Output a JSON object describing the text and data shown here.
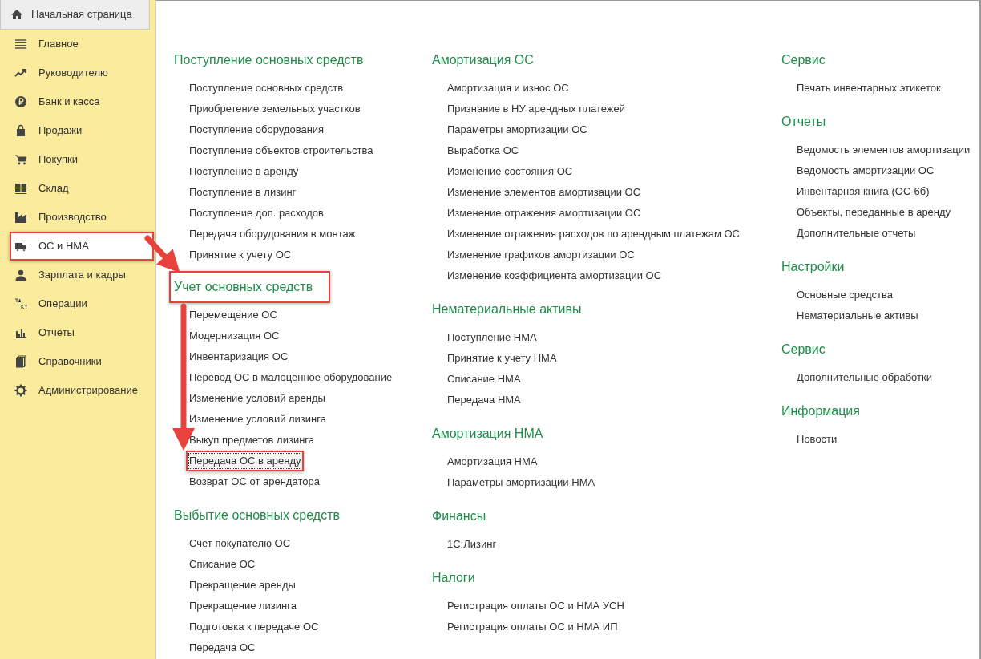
{
  "home_tab": {
    "label": "Начальная страница"
  },
  "sidebar": {
    "items": [
      {
        "label": "Главное",
        "selected": false,
        "highlighted": false
      },
      {
        "label": "Руководителю",
        "selected": false,
        "highlighted": false
      },
      {
        "label": "Банк и касса",
        "selected": false,
        "highlighted": false
      },
      {
        "label": "Продажи",
        "selected": false,
        "highlighted": false
      },
      {
        "label": "Покупки",
        "selected": false,
        "highlighted": false
      },
      {
        "label": "Склад",
        "selected": false,
        "highlighted": false
      },
      {
        "label": "Производство",
        "selected": false,
        "highlighted": false
      },
      {
        "label": "ОС и НМА",
        "selected": true,
        "highlighted": true
      },
      {
        "label": "Зарплата и кадры",
        "selected": false,
        "highlighted": false
      },
      {
        "label": "Операции",
        "selected": false,
        "highlighted": false
      },
      {
        "label": "Отчеты",
        "selected": false,
        "highlighted": false
      },
      {
        "label": "Справочники",
        "selected": false,
        "highlighted": false
      },
      {
        "label": "Администрирование",
        "selected": false,
        "highlighted": false
      }
    ]
  },
  "columns": [
    {
      "sections": [
        {
          "title": "Поступление основных средств",
          "highlighted": false,
          "items": [
            {
              "label": "Поступление основных средств",
              "focused": false,
              "highlighted": false
            },
            {
              "label": "Приобретение земельных участков",
              "focused": false,
              "highlighted": false
            },
            {
              "label": "Поступление оборудования",
              "focused": false,
              "highlighted": false
            },
            {
              "label": "Поступление объектов строительства",
              "focused": false,
              "highlighted": false
            },
            {
              "label": "Поступление в аренду",
              "focused": false,
              "highlighted": false
            },
            {
              "label": "Поступление в лизинг",
              "focused": false,
              "highlighted": false
            },
            {
              "label": "Поступление доп. расходов",
              "focused": false,
              "highlighted": false
            },
            {
              "label": "Передача оборудования в монтаж",
              "focused": false,
              "highlighted": false
            },
            {
              "label": "Принятие к учету ОС",
              "focused": false,
              "highlighted": false
            }
          ]
        },
        {
          "title": "Учет основных средств",
          "highlighted": true,
          "items": [
            {
              "label": "Перемещение ОС",
              "focused": false,
              "highlighted": false
            },
            {
              "label": "Модернизация ОС",
              "focused": false,
              "highlighted": false
            },
            {
              "label": "Инвентаризация ОС",
              "focused": false,
              "highlighted": false
            },
            {
              "label": "Перевод ОС в малоценное оборудование",
              "focused": false,
              "highlighted": false
            },
            {
              "label": "Изменение условий аренды",
              "focused": false,
              "highlighted": false
            },
            {
              "label": "Изменение условий лизинга",
              "focused": false,
              "highlighted": false
            },
            {
              "label": "Выкуп предметов лизинга",
              "focused": false,
              "highlighted": false
            },
            {
              "label": "Передача ОС в аренду",
              "focused": true,
              "highlighted": true
            },
            {
              "label": "Возврат ОС от арендатора",
              "focused": false,
              "highlighted": false
            }
          ]
        },
        {
          "title": "Выбытие основных средств",
          "highlighted": false,
          "items": [
            {
              "label": "Счет покупателю ОС",
              "focused": false,
              "highlighted": false
            },
            {
              "label": "Списание ОС",
              "focused": false,
              "highlighted": false
            },
            {
              "label": "Прекращение аренды",
              "focused": false,
              "highlighted": false
            },
            {
              "label": "Прекращение лизинга",
              "focused": false,
              "highlighted": false
            },
            {
              "label": "Подготовка к передаче ОС",
              "focused": false,
              "highlighted": false
            },
            {
              "label": "Передача ОС",
              "focused": false,
              "highlighted": false
            }
          ]
        }
      ]
    },
    {
      "sections": [
        {
          "title": "Амортизация ОС",
          "highlighted": false,
          "items": [
            {
              "label": "Амортизация и износ ОС",
              "focused": false,
              "highlighted": false
            },
            {
              "label": "Признание в НУ арендных платежей",
              "focused": false,
              "highlighted": false
            },
            {
              "label": "Параметры амортизации ОС",
              "focused": false,
              "highlighted": false
            },
            {
              "label": "Выработка ОС",
              "focused": false,
              "highlighted": false
            },
            {
              "label": "Изменение состояния ОС",
              "focused": false,
              "highlighted": false
            },
            {
              "label": "Изменение элементов амортизации ОС",
              "focused": false,
              "highlighted": false
            },
            {
              "label": "Изменение отражения амортизации ОС",
              "focused": false,
              "highlighted": false
            },
            {
              "label": "Изменение отражения расходов по арендным платежам ОС",
              "focused": false,
              "highlighted": false
            },
            {
              "label": "Изменение графиков амортизации ОС",
              "focused": false,
              "highlighted": false
            },
            {
              "label": "Изменение коэффициента амортизации ОС",
              "focused": false,
              "highlighted": false
            }
          ]
        },
        {
          "title": "Нематериальные активы",
          "highlighted": false,
          "items": [
            {
              "label": "Поступление НМА",
              "focused": false,
              "highlighted": false
            },
            {
              "label": "Принятие к учету НМА",
              "focused": false,
              "highlighted": false
            },
            {
              "label": "Списание НМА",
              "focused": false,
              "highlighted": false
            },
            {
              "label": "Передача НМА",
              "focused": false,
              "highlighted": false
            }
          ]
        },
        {
          "title": "Амортизация НМА",
          "highlighted": false,
          "items": [
            {
              "label": "Амортизация НМА",
              "focused": false,
              "highlighted": false
            },
            {
              "label": "Параметры амортизации НМА",
              "focused": false,
              "highlighted": false
            }
          ]
        },
        {
          "title": "Финансы",
          "highlighted": false,
          "items": [
            {
              "label": "1С:Лизинг",
              "focused": false,
              "highlighted": false
            }
          ]
        },
        {
          "title": "Налоги",
          "highlighted": false,
          "items": [
            {
              "label": "Регистрация оплаты ОС и НМА УСН",
              "focused": false,
              "highlighted": false
            },
            {
              "label": "Регистрация оплаты ОС и НМА ИП",
              "focused": false,
              "highlighted": false
            }
          ]
        }
      ]
    },
    {
      "sections": [
        {
          "title": "Сервис",
          "highlighted": false,
          "items": [
            {
              "label": "Печать инвентарных этикеток",
              "focused": false,
              "highlighted": false
            }
          ]
        },
        {
          "title": "Отчеты",
          "highlighted": false,
          "items": [
            {
              "label": "Ведомость элементов амортизации",
              "focused": false,
              "highlighted": false
            },
            {
              "label": "Ведомость амортизации ОС",
              "focused": false,
              "highlighted": false
            },
            {
              "label": "Инвентарная книга (ОС-6б)",
              "focused": false,
              "highlighted": false
            },
            {
              "label": "Объекты, переданные в аренду",
              "focused": false,
              "highlighted": false
            },
            {
              "label": "Дополнительные отчеты",
              "focused": false,
              "highlighted": false
            }
          ]
        },
        {
          "title": "Настройки",
          "highlighted": false,
          "items": [
            {
              "label": "Основные средства",
              "focused": false,
              "highlighted": false
            },
            {
              "label": "Нематериальные активы",
              "focused": false,
              "highlighted": false
            }
          ]
        },
        {
          "title": "Сервис",
          "highlighted": false,
          "items": [
            {
              "label": "Дополнительные обработки",
              "focused": false,
              "highlighted": false
            }
          ]
        },
        {
          "title": "Информация",
          "highlighted": false,
          "items": [
            {
              "label": "Новости",
              "focused": false,
              "highlighted": false
            }
          ]
        }
      ]
    }
  ]
}
